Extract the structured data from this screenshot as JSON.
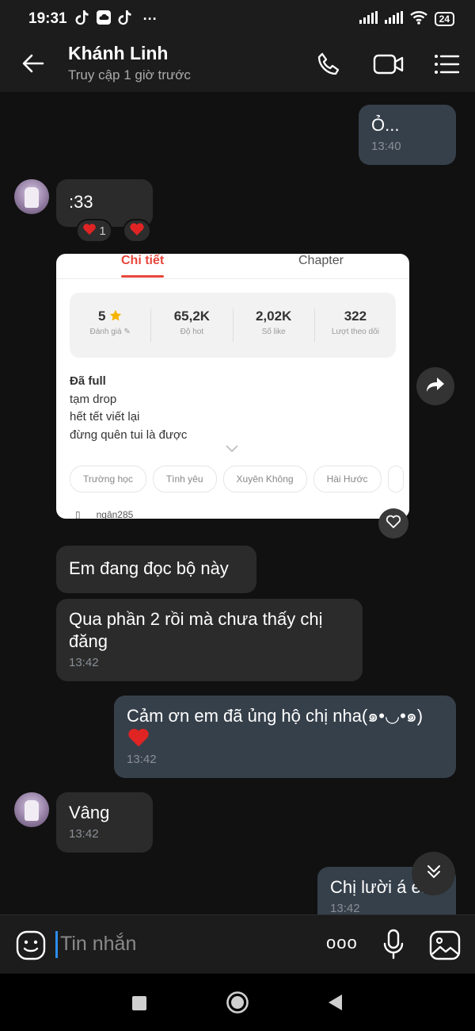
{
  "status_bar": {
    "time": "19:31",
    "battery": "24",
    "overflow": "···"
  },
  "header": {
    "contact_name": "Khánh Linh",
    "last_seen": "Truy cập 1 giờ trước"
  },
  "messages": [
    {
      "id": "m1",
      "direction": "out",
      "text": "Ỏ...",
      "time": "13:40"
    },
    {
      "id": "m2",
      "direction": "in",
      "text": ":33",
      "time": ""
    },
    {
      "id": "m3",
      "direction": "in",
      "text": "Em đang đọc bộ này",
      "time": ""
    },
    {
      "id": "m4",
      "direction": "in",
      "text": "Qua phần 2 rồi mà chưa thấy chị đăng",
      "time": "13:42"
    },
    {
      "id": "m5",
      "direction": "out",
      "text": "Cảm ơn em đã ủng hộ chị nha(๑•◡•๑)",
      "time": "13:42"
    },
    {
      "id": "m6",
      "direction": "in",
      "text": "Vâng",
      "time": "13:42"
    },
    {
      "id": "m7",
      "direction": "out",
      "text": "Chị lười á e...",
      "time": "13:42"
    }
  ],
  "reactions": {
    "m2_count": "1"
  },
  "shared_card": {
    "tab_active": "Chi tiết",
    "tab_other": "Chapter",
    "stats": [
      {
        "value": "5",
        "label": "Đánh giá"
      },
      {
        "value": "65,2K",
        "label": "Độ hot"
      },
      {
        "value": "2,02K",
        "label": "Số like"
      },
      {
        "value": "322",
        "label": "Lượt theo dõi"
      }
    ],
    "status": "Đã full",
    "desc_lines": [
      "tạm drop",
      "hết tết viết lại",
      "đừng quên tui là được"
    ],
    "tags": [
      "Trường học",
      "Tình yêu",
      "Xuyên Không",
      "Hài Hước"
    ],
    "author": "ngân285"
  },
  "composer": {
    "placeholder": "Tin nhắn",
    "more": "ooo"
  },
  "icons": {
    "back": "arrow-left-icon",
    "call": "phone-icon",
    "video": "video-camera-icon",
    "menu": "menu-icon",
    "share": "share-arrow-icon",
    "react": "heart-outline-icon",
    "scroll": "double-chevron-down-icon",
    "emoji": "emoji-icon",
    "mic": "microphone-icon",
    "image": "image-icon"
  },
  "colors": {
    "heart": "#e02424",
    "accent_red": "#e8473c",
    "input_caret": "#2d8cf0"
  }
}
